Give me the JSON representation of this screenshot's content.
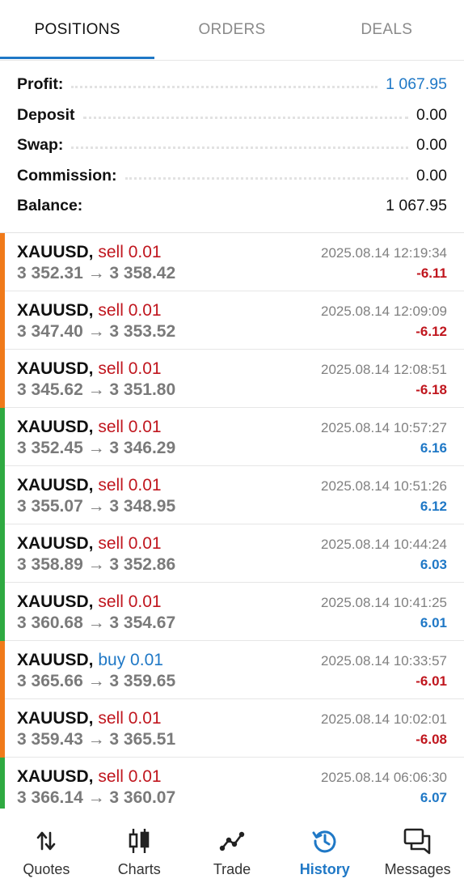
{
  "colors": {
    "accent": "#1f78c6",
    "loss": "#c0161e",
    "profit_bar": "#2faa41",
    "loss_bar": "#f07a1a"
  },
  "tabs": [
    {
      "label": "POSITIONS",
      "active": true
    },
    {
      "label": "ORDERS",
      "active": false
    },
    {
      "label": "DEALS",
      "active": false
    }
  ],
  "summary": {
    "profit_label": "Profit:",
    "profit_value": "1 067.95",
    "deposit_label": "Deposit",
    "deposit_value": "0.00",
    "swap_label": "Swap:",
    "swap_value": "0.00",
    "commission_label": "Commission:",
    "commission_value": "0.00",
    "balance_label": "Balance:",
    "balance_value": "1 067.95"
  },
  "deals": [
    {
      "symbol": "XAUUSD,",
      "side": "sell 0.01",
      "prices": "3 352.31 → 3 358.42",
      "time": "2025.08.14 12:19:34",
      "pnl": "-6.11"
    },
    {
      "symbol": "XAUUSD,",
      "side": "sell 0.01",
      "prices": "3 347.40 → 3 353.52",
      "time": "2025.08.14 12:09:09",
      "pnl": "-6.12"
    },
    {
      "symbol": "XAUUSD,",
      "side": "sell 0.01",
      "prices": "3 345.62 → 3 351.80",
      "time": "2025.08.14 12:08:51",
      "pnl": "-6.18"
    },
    {
      "symbol": "XAUUSD,",
      "side": "sell 0.01",
      "prices": "3 352.45 → 3 346.29",
      "time": "2025.08.14 10:57:27",
      "pnl": "6.16"
    },
    {
      "symbol": "XAUUSD,",
      "side": "sell 0.01",
      "prices": "3 355.07 → 3 348.95",
      "time": "2025.08.14 10:51:26",
      "pnl": "6.12"
    },
    {
      "symbol": "XAUUSD,",
      "side": "sell 0.01",
      "prices": "3 358.89 → 3 352.86",
      "time": "2025.08.14 10:44:24",
      "pnl": "6.03"
    },
    {
      "symbol": "XAUUSD,",
      "side": "sell 0.01",
      "prices": "3 360.68 → 3 354.67",
      "time": "2025.08.14 10:41:25",
      "pnl": "6.01"
    },
    {
      "symbol": "XAUUSD,",
      "side": "buy 0.01",
      "prices": "3 365.66 → 3 359.65",
      "time": "2025.08.14 10:33:57",
      "pnl": "-6.01"
    },
    {
      "symbol": "XAUUSD,",
      "side": "sell 0.01",
      "prices": "3 359.43 → 3 365.51",
      "time": "2025.08.14 10:02:01",
      "pnl": "-6.08"
    },
    {
      "symbol": "XAUUSD,",
      "side": "sell 0.01",
      "prices": "3 366.14 → 3 360.07",
      "time": "2025.08.14 06:06:30",
      "pnl": "6.07"
    }
  ],
  "nav": [
    {
      "label": "Quotes",
      "icon": "quotes-icon"
    },
    {
      "label": "Charts",
      "icon": "charts-icon"
    },
    {
      "label": "Trade",
      "icon": "trade-icon"
    },
    {
      "label": "History",
      "icon": "history-icon",
      "active": true
    },
    {
      "label": "Messages",
      "icon": "messages-icon"
    }
  ]
}
